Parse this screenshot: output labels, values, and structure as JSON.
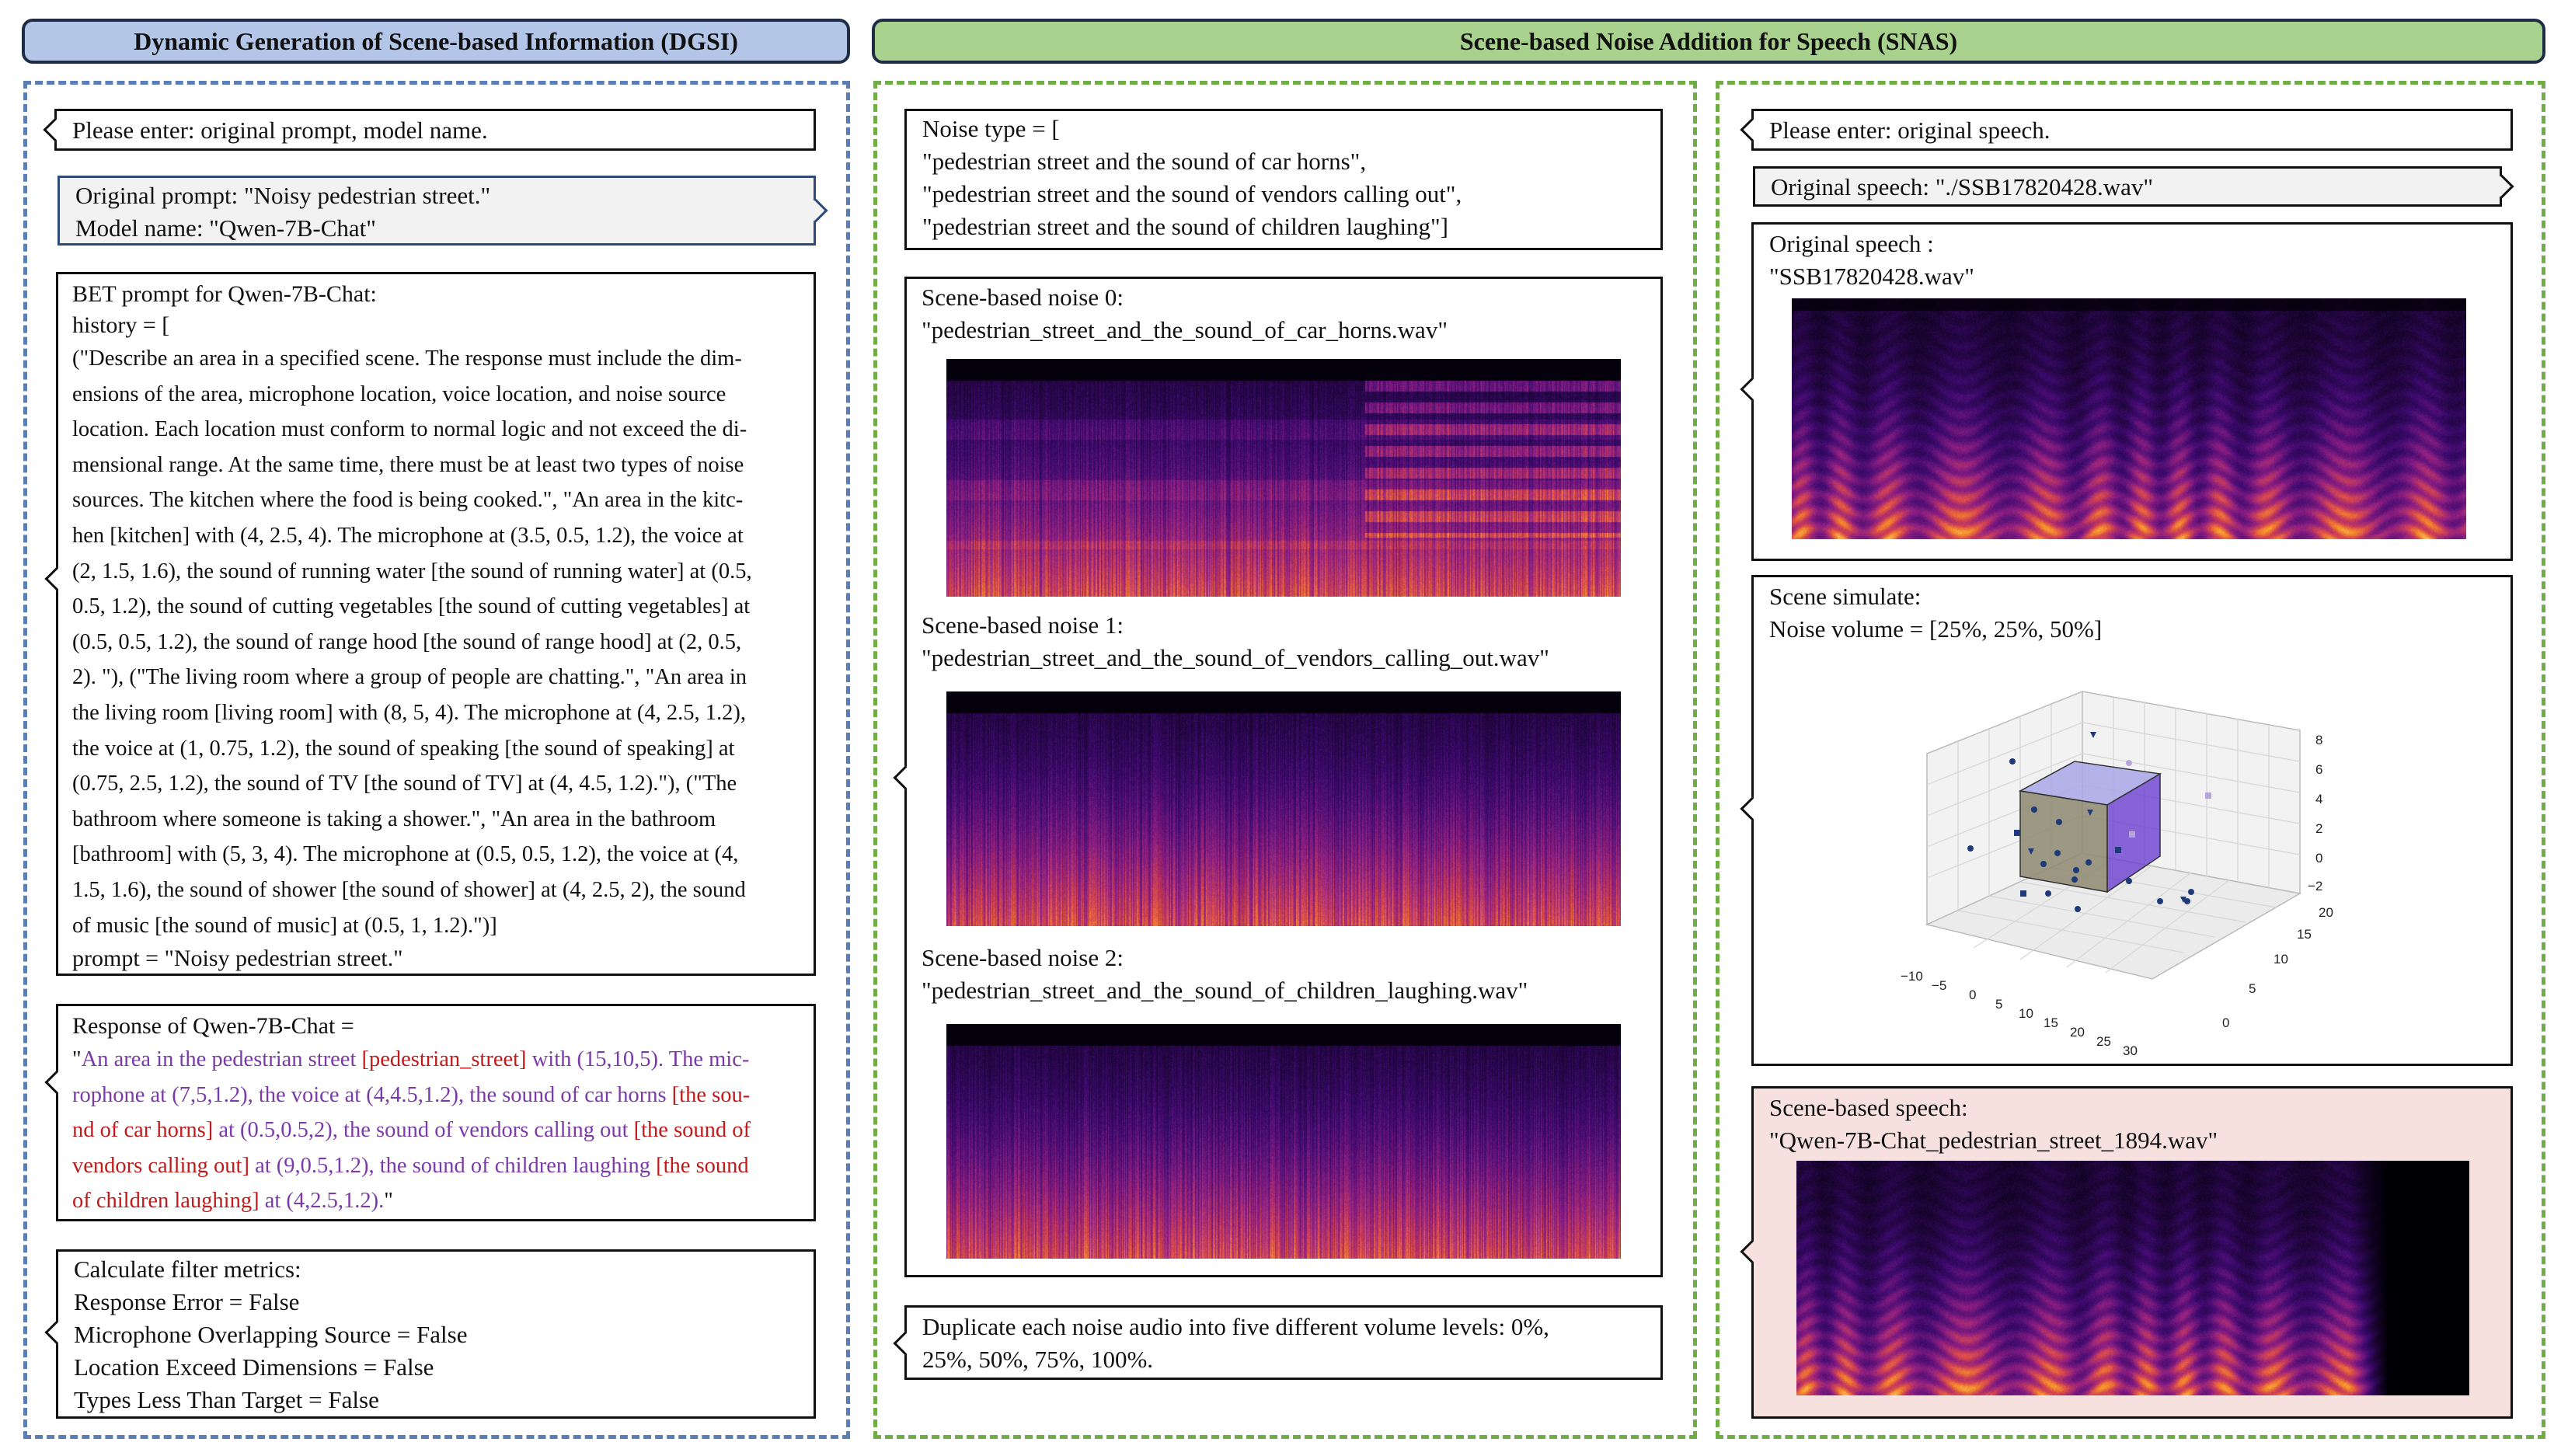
{
  "headers": {
    "dgsi": "Dynamic Generation of Scene-based Information (DGSI)",
    "snas": "Scene-based Noise Addition for Speech (SNAS)"
  },
  "colors": {
    "dgsi_header_bg": "#b4c6e7",
    "snas_header_bg": "#a9d18e",
    "dgsi_region_border": "#5b7fb5",
    "snas_region_border": "#70ad47",
    "scene_speech_bg": "#f7e1df",
    "response_purple": "#7a3aa8",
    "response_red": "#c01a1a"
  },
  "dgsi": {
    "input_box": "Please enter: original prompt, model name.",
    "values_box": {
      "line1": "Original prompt: \"Noisy pedestrian street.\"",
      "line2": "Model name: \"Qwen-7B-Chat\""
    },
    "bet_box": {
      "line1": "BET prompt for Qwen-7B-Chat:",
      "line2": "history = [",
      "body": [
        "(\"Describe an area in a specified scene. The response must include the dim-",
        "ensions of the area, microphone location, voice location, and noise source",
        "location. Each location must conform to normal logic and not exceed the di-",
        "mensional range. At the same time, there must be at least two types of noise",
        "sources. The kitchen where the food is being cooked.\", \"An area in the kitc-",
        "hen [kitchen] with (4, 2.5, 4). The microphone at (3.5, 0.5, 1.2), the voice at",
        "(2, 1.5, 1.6), the sound of running water [the sound of running water] at (0.5,",
        "0.5, 1.2), the sound of cutting vegetables [the sound of cutting vegetables] at",
        "(0.5, 0.5, 1.2), the sound of range hood [the sound of range hood] at (2, 0.5,",
        "2). \"), (\"The living room where a group of people are chatting.\", \"An area in",
        "the living room [living room] with (8, 5, 4). The microphone at (4, 2.5, 1.2),",
        "the voice at (1, 0.75, 1.2), the sound of speaking [the sound of speaking] at",
        "(0.75, 2.5, 1.2), the sound of TV [the sound of TV] at (4, 4.5, 1.2).\"), (\"The",
        "bathroom where someone is taking a shower.\", \"An area in the bathroom",
        "[bathroom] with (5, 3, 4). The microphone at (0.5, 0.5, 1.2), the voice at (4,",
        "1.5, 1.6), the sound of shower [the sound of shower] at (4, 2.5, 2), the sound",
        "of music [the sound of music] at (0.5, 1, 1.2).\")]"
      ],
      "last": "prompt = \"Noisy pedestrian street.\""
    },
    "response_box": {
      "head": "Response of Qwen-7B-Chat =",
      "r1a": "\"",
      "r1b": "An area in the pedestrian street ",
      "r1c": "[pedestrian_street]",
      "r1d": " with (15,10,5). The mic-",
      "r2a": "rophone at (7,5,1.2), the voice at (4,4.5,1.2), the sound of car horns ",
      "r2b": "[the sou-",
      "r3a": "nd of car horns]",
      "r3b": " at (0.5,0.5,2), the sound of vendors calling out ",
      "r3c": "[the sound of",
      "r4a": "vendors calling out]",
      "r4b": " at (9,0.5,1.2), the sound of children laughing ",
      "r4c": "[the sound",
      "r5a": "of children laughing]",
      "r5b": " at (4,2.5,1.2).",
      "r5c": "\""
    },
    "metrics_box": {
      "line1": "Calculate filter metrics:",
      "line2": "Response Error = False",
      "line3": "Microphone Overlapping Source = False",
      "line4": "Location Exceed Dimensions = False",
      "line5": "Types Less Than Target = False"
    }
  },
  "snas_mid": {
    "noise_type": {
      "line1": "Noise type = [",
      "line2": "\"pedestrian street and the sound of car horns\",",
      "line3": "\"pedestrian street and the sound of vendors calling out\",",
      "line4": "\"pedestrian street and the sound of children laughing\"]"
    },
    "noise0": {
      "line1": "Scene-based noise 0:",
      "line2": "\"pedestrian_street_and_the_sound_of_car_horns.wav\""
    },
    "noise1": {
      "line1": "Scene-based noise 1:",
      "line2": "\"pedestrian_street_and_the_sound_of_vendors_calling_out.wav\""
    },
    "noise2": {
      "line1": "Scene-based noise 2:",
      "line2": "\"pedestrian_street_and_the_sound_of_children_laughing.wav\""
    },
    "duplicate": {
      "line1": "Duplicate each noise audio into five different volume levels: 0%,",
      "line2": "25%, 50%, 75%, 100%."
    }
  },
  "snas_right": {
    "input_box": "Please enter: original speech.",
    "value_box": "Original speech: \"./SSB17820428.wav\"",
    "orig_speech": {
      "line1": "Original speech :",
      "line2": "\"SSB17820428.wav\""
    },
    "scene_sim": {
      "line1": "Scene simulate:",
      "line2": "Noise volume = [25%, 25%, 50%]"
    },
    "plot": {
      "x_ticks": [
        "−10",
        "−5",
        "0",
        "5",
        "10",
        "15",
        "20",
        "25",
        "30"
      ],
      "y_ticks": [
        "0",
        "5",
        "10",
        "15",
        "20"
      ],
      "z_ticks": [
        "−2",
        "0",
        "2",
        "4",
        "6",
        "8"
      ]
    },
    "scene_speech": {
      "line1": "Scene-based speech:",
      "line2": "\"Qwen-7B-Chat_pedestrian_street_1894.wav\""
    }
  }
}
